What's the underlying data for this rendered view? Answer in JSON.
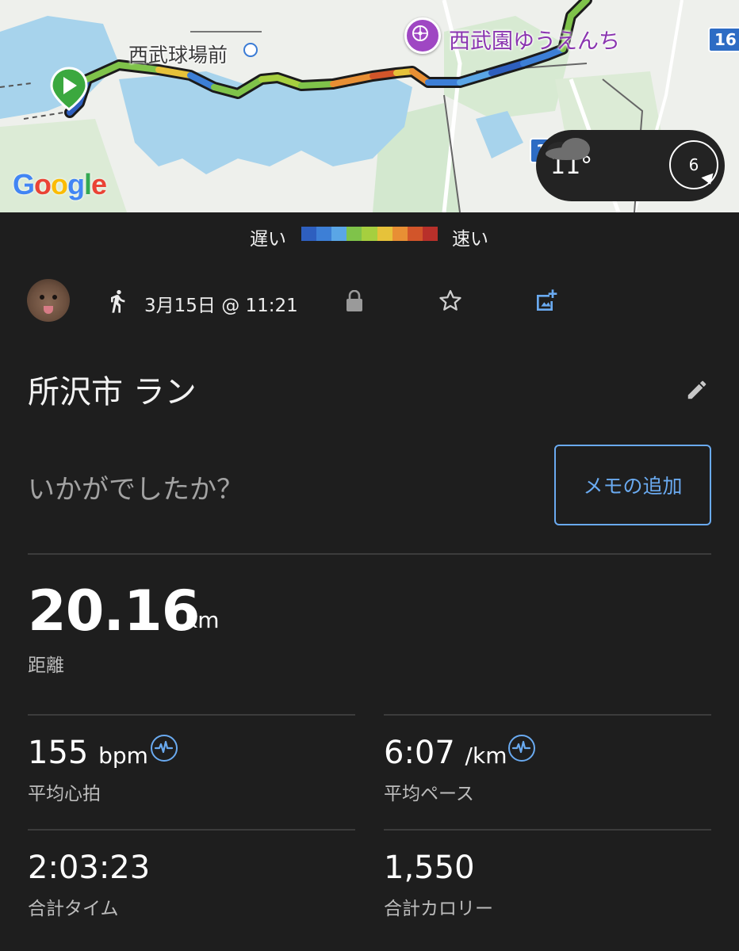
{
  "map": {
    "place_labels": [
      "西武球場前",
      "西武園ゆうえんち"
    ],
    "road_badges": [
      "16",
      "1"
    ],
    "logo_text": "Google",
    "weather": {
      "temperature": "11°",
      "wind_speed": "6"
    }
  },
  "legend": {
    "slow_label": "遅い",
    "fast_label": "速い",
    "colors": [
      "#2e5fbf",
      "#3d7fd6",
      "#5aa6e6",
      "#7fc34a",
      "#a6cf3f",
      "#e6c23a",
      "#e88f34",
      "#d2552a",
      "#b8302a"
    ]
  },
  "activity": {
    "date": "3月15日 @ 11:21",
    "title": "所沢市 ラン",
    "prompt": "いかがでしたか？",
    "memo_button": "メモの追加"
  },
  "stats": {
    "distance": {
      "value": "20.16",
      "unit": "km",
      "label": "距離"
    },
    "avg_hr": {
      "value": "155",
      "unit": "bpm",
      "label": "平均心拍"
    },
    "avg_pace": {
      "value": "6:07",
      "unit": "/km",
      "label": "平均ペース"
    },
    "total_time": {
      "value": "2:03:23",
      "label": "合計タイム"
    },
    "total_calories": {
      "value": "1,550",
      "label": "合計カロリー"
    }
  },
  "icons": {
    "start_marker": "play-marker-icon",
    "poi": "amusement-park-icon",
    "activity_type": "running-icon",
    "privacy": "lock-icon",
    "favorite": "star-icon",
    "add_photo": "add-photo-icon",
    "edit": "pencil-icon",
    "heart_rate": "heart-rate-icon",
    "pace": "pace-icon",
    "weather": "cloud-icon",
    "wind": "wind-direction-icon"
  },
  "accent_color": "#6aaaf0"
}
